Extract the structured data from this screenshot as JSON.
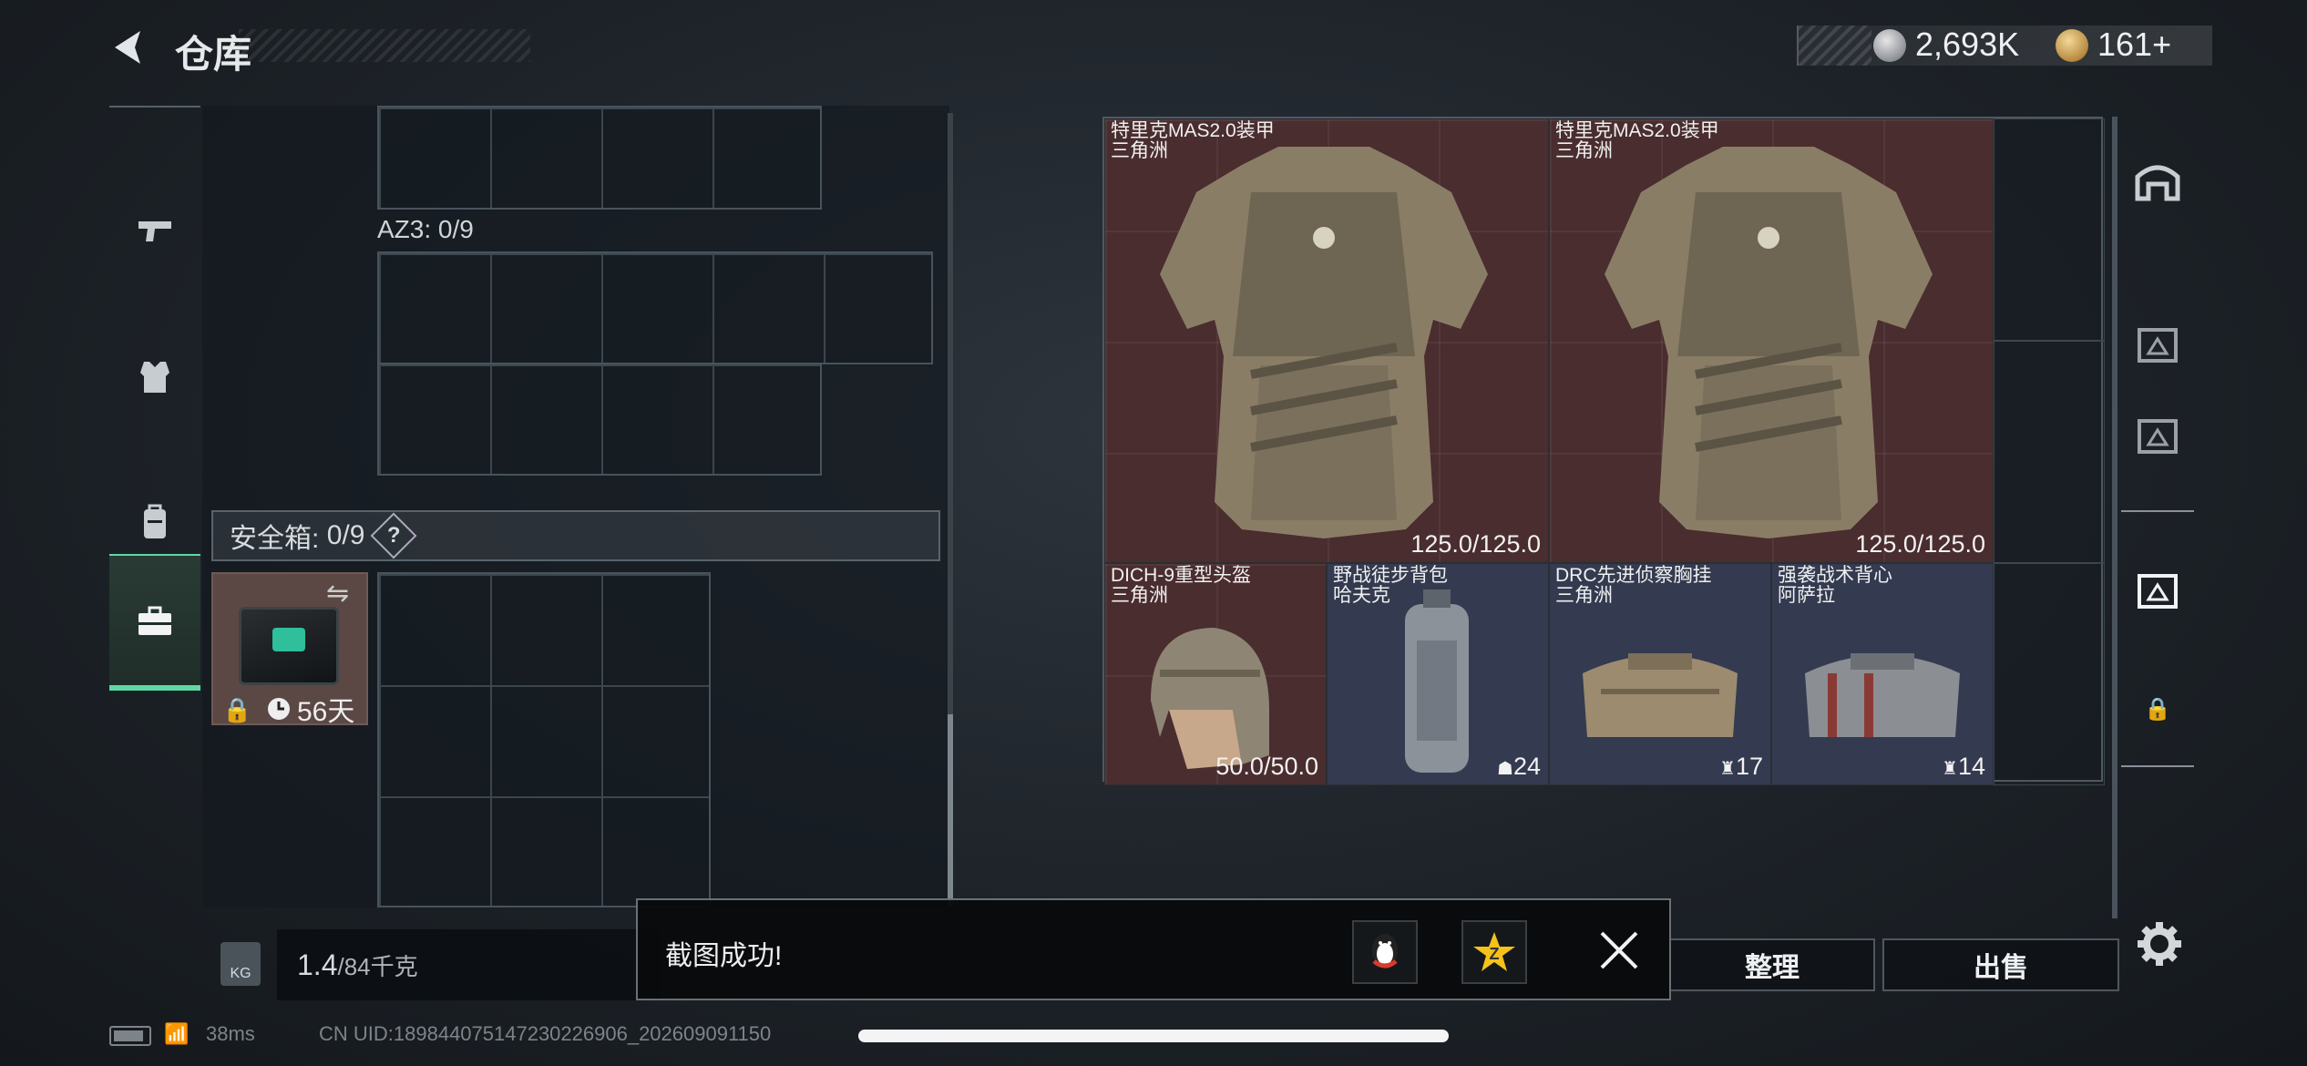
{
  "header": {
    "title": "仓库",
    "currency_silver": "2,693K",
    "currency_gold": "161+",
    "colors": {
      "accent": "#5fd9a3",
      "item_red": "#4a2d2f",
      "item_blue": "#343b50"
    }
  },
  "left_tabs": [
    {
      "icon": "pistol-icon"
    },
    {
      "icon": "armor-vest-icon"
    },
    {
      "icon": "backpack-icon"
    },
    {
      "icon": "toolbox-icon",
      "active": true
    }
  ],
  "storage": {
    "az3_label": "AZ3: 0/9",
    "safe_label": "安全箱:",
    "safe_count": "0/9",
    "safe_help": "?",
    "safe_days": "56天",
    "weight_value": "1.4",
    "weight_total": "/84千克",
    "weight_badge": "KG"
  },
  "items": [
    {
      "name": "特里克MAS2.0装甲",
      "origin": "三角洲",
      "value": "125.0/125.0",
      "rarity": "red"
    },
    {
      "name": "特里克MAS2.0装甲",
      "origin": "三角洲",
      "value": "125.0/125.0",
      "rarity": "red"
    },
    {
      "name": "DICH-9重型头盔",
      "origin": "三角洲",
      "value": "50.0/50.0",
      "rarity": "red"
    },
    {
      "name": "野战徒步背包",
      "origin": "哈夫克",
      "value": "24",
      "rarity": "blue"
    },
    {
      "name": "DRC先进侦察胸挂",
      "origin": "三角洲",
      "value": "17",
      "rarity": "blue"
    },
    {
      "name": "强袭战术背心",
      "origin": "阿萨拉",
      "value": "14",
      "rarity": "blue"
    }
  ],
  "actions": {
    "sort": "整理",
    "sell": "出售"
  },
  "toast": {
    "message": "截图成功!"
  },
  "status": {
    "ping": "38ms",
    "uid": "CN UID:18984407514723022690​6_202609091150"
  }
}
